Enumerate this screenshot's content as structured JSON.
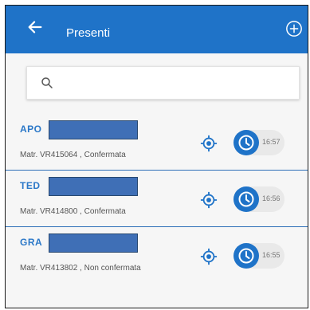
{
  "appbar": {
    "title": "Presenti",
    "back_icon": "arrow-left-icon",
    "add_icon": "plus-circle-icon",
    "color": "#1f73c8"
  },
  "search": {
    "icon": "search-icon",
    "placeholder": "",
    "value": ""
  },
  "employees": [
    {
      "name": "APO",
      "matr": "Matr. VR415064 , Confermata",
      "time": "16:57"
    },
    {
      "name": "TED",
      "matr": "Matr. VR414800 , Confermata",
      "time": "16:56"
    },
    {
      "name": "GRA",
      "matr": "Matr. VR413802 , Non confermata",
      "time": "16:55"
    }
  ],
  "colors": {
    "accent": "#1f73c8",
    "name_text": "#2b78c8",
    "redaction": "#3f6fb6"
  }
}
